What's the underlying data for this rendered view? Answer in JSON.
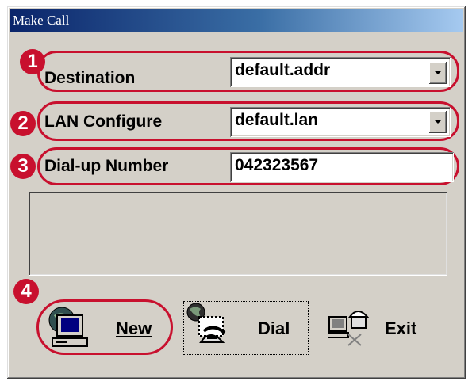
{
  "window": {
    "title": "Make Call"
  },
  "form": {
    "destination": {
      "label": "Destination",
      "value": "default.addr"
    },
    "lan": {
      "label": "LAN Configure",
      "value": "default.lan"
    },
    "dialup": {
      "label": "Dial-up Number",
      "value": "042323567"
    }
  },
  "status": {
    "text": ""
  },
  "buttons": {
    "new": {
      "label": "New"
    },
    "dial": {
      "label": "Dial"
    },
    "exit": {
      "label": "Exit"
    }
  },
  "callouts": [
    "1",
    "2",
    "3",
    "4"
  ],
  "colors": {
    "callout": "#c8102e",
    "titlebar": "#0a246a",
    "face": "#d4d0c8"
  }
}
